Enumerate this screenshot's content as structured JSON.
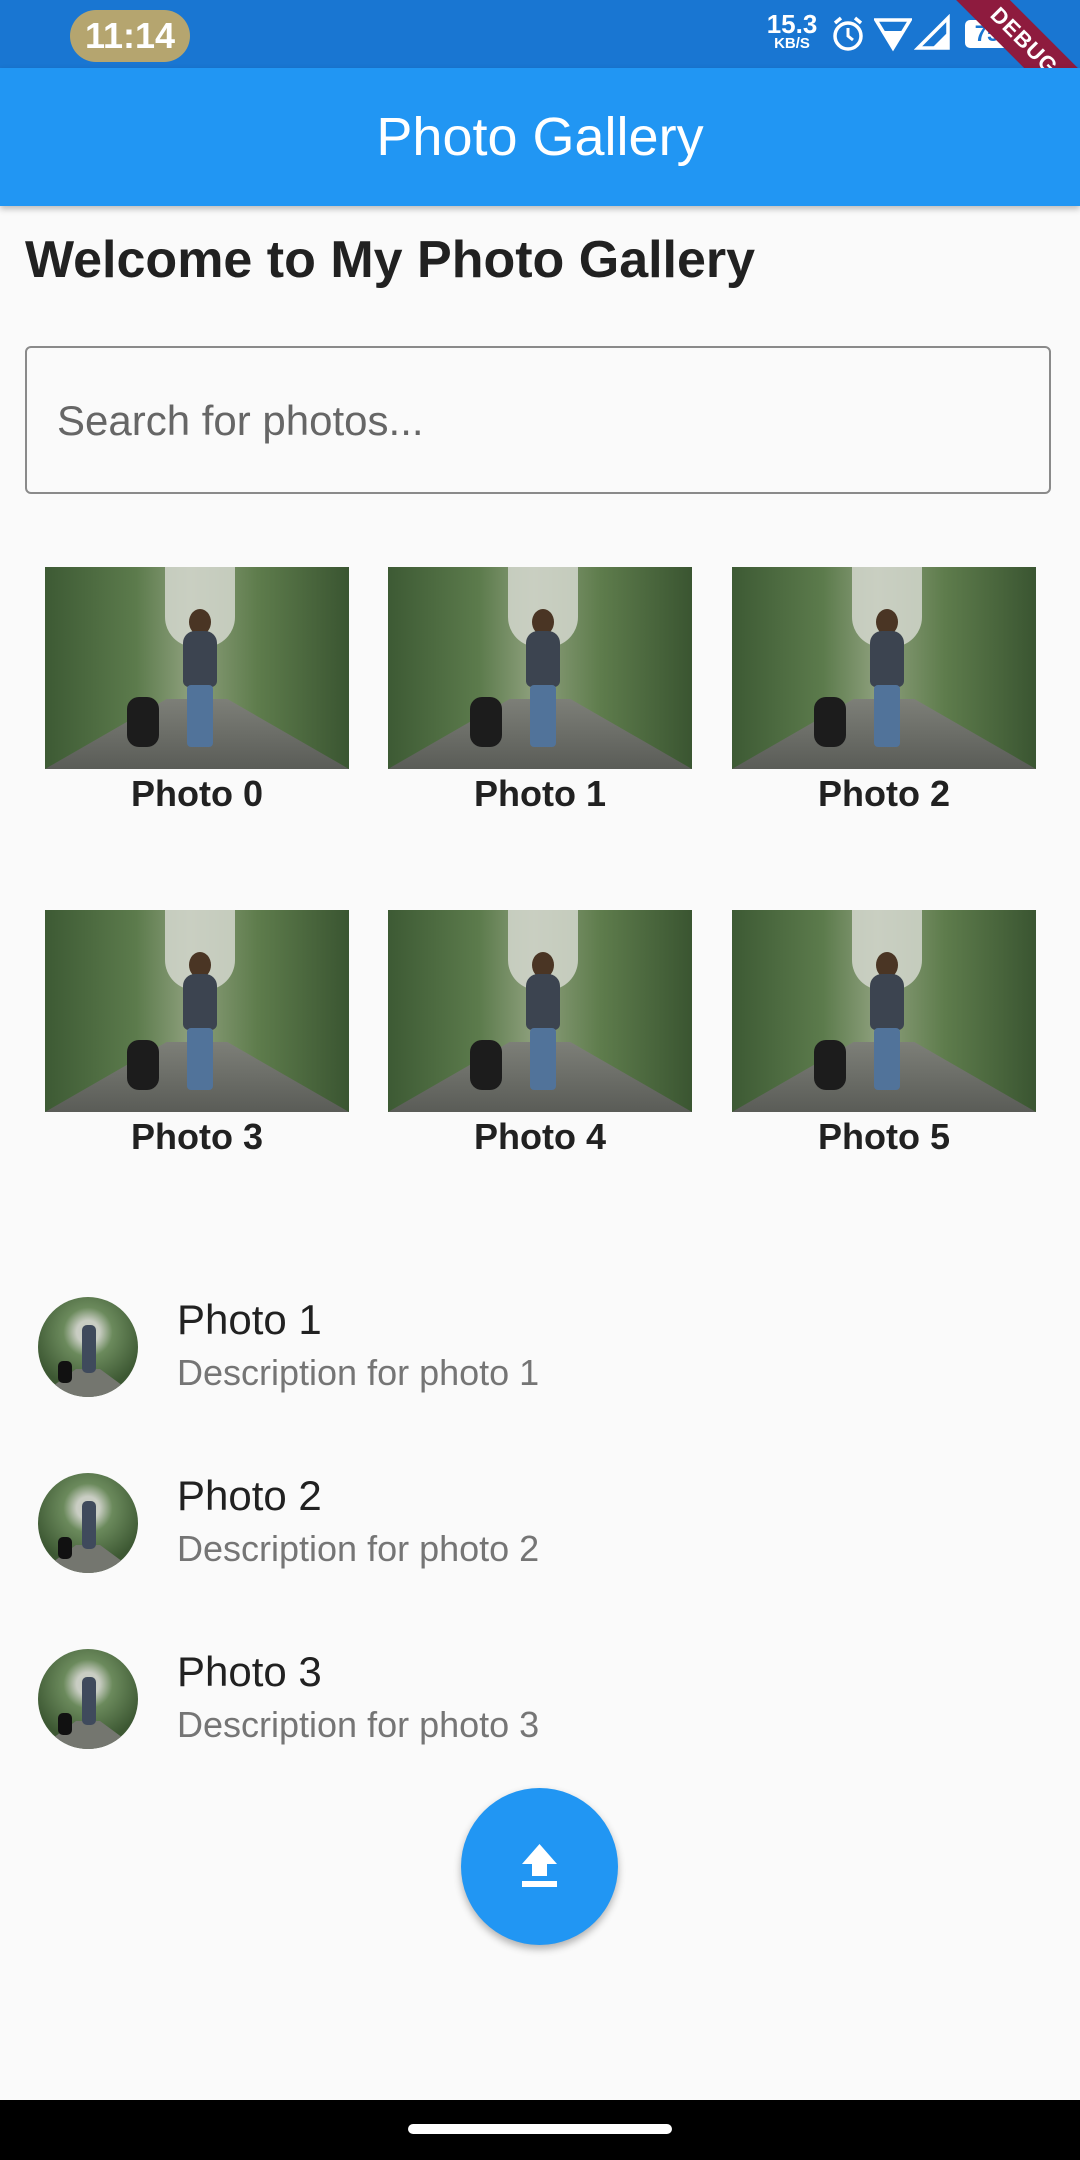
{
  "status_bar": {
    "time": "11:14",
    "net_speed_value": "15.3",
    "net_speed_unit": "KB/S",
    "battery": "75",
    "icons": [
      "alarm-icon",
      "wifi-icon",
      "signal-icon",
      "battery-icon"
    ]
  },
  "debug_banner": "DEBUG",
  "app_bar": {
    "title": "Photo Gallery"
  },
  "heading": "Welcome to My Photo Gallery",
  "search": {
    "placeholder": "Search for photos...",
    "value": ""
  },
  "grid": [
    {
      "label": "Photo 0"
    },
    {
      "label": "Photo 1"
    },
    {
      "label": "Photo 2"
    },
    {
      "label": "Photo 3"
    },
    {
      "label": "Photo 4"
    },
    {
      "label": "Photo 5"
    }
  ],
  "list": [
    {
      "title": "Photo 1",
      "subtitle": "Description for photo 1"
    },
    {
      "title": "Photo 2",
      "subtitle": "Description for photo 2"
    },
    {
      "title": "Photo 3",
      "subtitle": "Description for photo 3"
    }
  ],
  "fab": {
    "icon": "upload-icon"
  },
  "colors": {
    "primary": "#2196f3",
    "status_bar": "#1976d2",
    "debug": "#8e1b3e"
  }
}
